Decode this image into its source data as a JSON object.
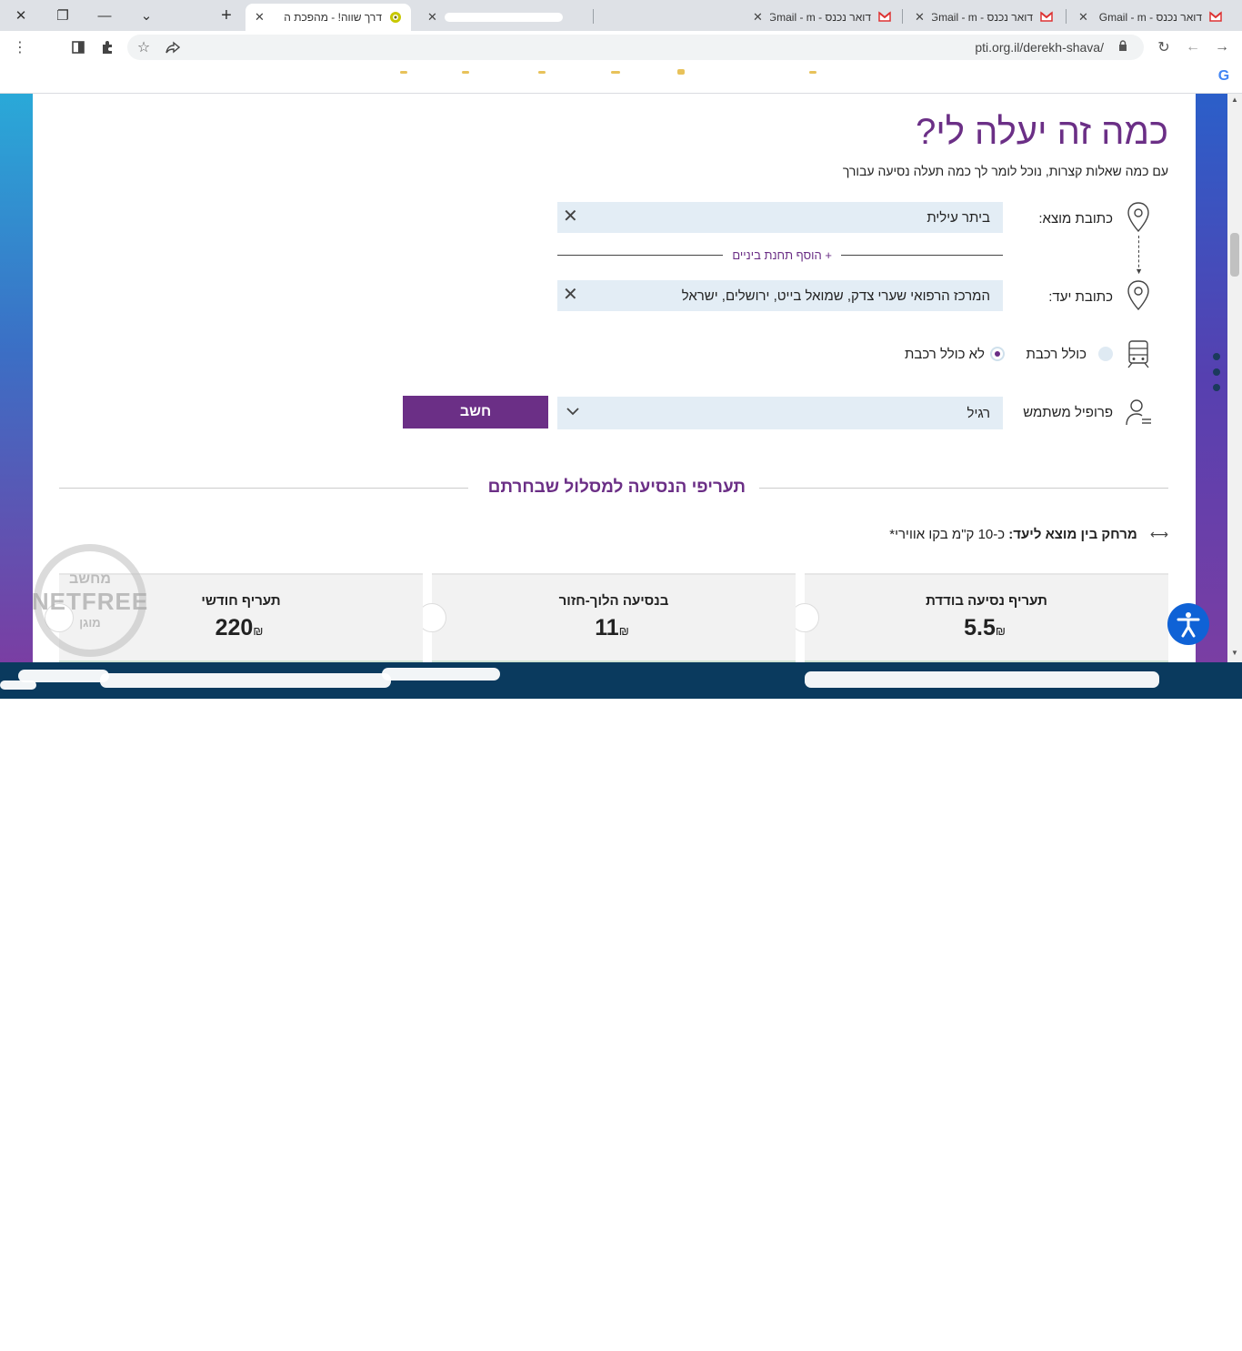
{
  "browser": {
    "tabs": [
      {
        "title": "דרך שווה! - מהפכת ה",
        "active": true
      },
      {
        "title": "",
        "active": false
      },
      {
        "title": "דואר נכנס - Gmail - m",
        "active": false
      },
      {
        "title": "דואר נכנס - Gmail - m",
        "active": false
      },
      {
        "title": "דואר נכנס - Gmail - m",
        "active": false
      }
    ],
    "url": "pti.org.il/derekh-shava/",
    "new_tab": "+",
    "close_glyph": "✕"
  },
  "page": {
    "title": "כמה זה יעלה לי?",
    "subtitle": "עם כמה שאלות קצרות, נוכל לומר לך כמה תעלה נסיעה עבורך",
    "origin": {
      "label": "כתובת מוצא:",
      "value": "ביתר עילית"
    },
    "add_stop": "+ הוסף תחנת ביניים",
    "destination": {
      "label": "כתובת יעד:",
      "value": "המרכז הרפואי שערי צדק, שמואל בייט, ירושלים, ישראל"
    },
    "train_options": [
      {
        "label": "כולל רכבת",
        "checked": false
      },
      {
        "label": "לא כולל רכבת",
        "checked": true
      }
    ],
    "profile": {
      "label": "פרופיל משתמש",
      "value": "רגיל"
    },
    "calc_button": "חשב",
    "results_title": "תעריפי הנסיעה למסלול שבחרתם",
    "distance": {
      "label": "מרחק בין מוצא ליעד:",
      "value": "כ-10 ק\"מ בקו אווירי*"
    },
    "cards": [
      {
        "title": "תעריף נסיעה בודדת",
        "value": "5.5",
        "currency": "₪"
      },
      {
        "title": "בנסיעה הלוך-חזור",
        "value": "11",
        "currency": "₪"
      },
      {
        "title": "תעריף חודשי",
        "value": "220",
        "currency": "₪"
      }
    ],
    "watermark": {
      "top": "מחשב",
      "main": "NETFREE",
      "bottom": "מוגן"
    }
  },
  "colors": {
    "accent": "#6b2f86",
    "field_bg": "#e3edf5",
    "taskbar": "#0a3a5e",
    "a11y": "#0f62d6"
  }
}
